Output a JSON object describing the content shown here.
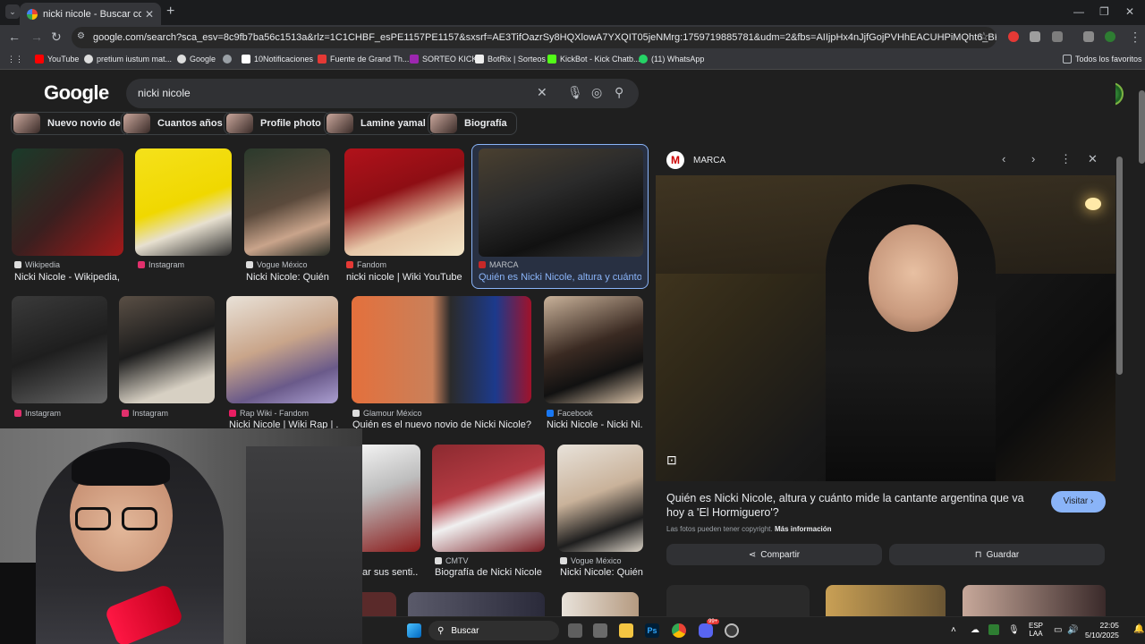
{
  "browser": {
    "tab_title": "nicki nicole - Buscar con Google",
    "url": "google.com/search?sca_esv=8c9fb7ba56c1513a&rlz=1C1CHBF_esPE1157PE1157&sxsrf=AE3TifOazrSy8HQXlowA7YXQIT05jeNMrg:1759719885781&udm=2&fbs=AIIjpHx4nJjfGojPVHhEACUHPiMQht6_BFq6vBIoFFRK7qchKHDX9TtpZ992ky...",
    "bookmarks": [
      "YouTube",
      "pretium iustum mat...",
      "Google",
      "",
      "10Notificaciones",
      "Fuente de Grand Th...",
      "SORTEO KICK",
      "BotRix | Sorteos",
      "KickBot - Kick Chatb...",
      "(11) WhatsApp"
    ],
    "all_bookmarks": "Todos los favoritos"
  },
  "google": {
    "logo": "Google",
    "query": "nicki nicole",
    "chips": [
      "Nuevo novio de",
      "Cuantos años",
      "Profile photo",
      "Lamine yamal",
      "Biografía"
    ]
  },
  "results": {
    "row1": [
      {
        "source": "Wikipedia",
        "title": "Nicki Nicole - Wikipedia, l..."
      },
      {
        "source": "Instagram",
        "title": ""
      },
      {
        "source": "Vogue México",
        "title": "Nicki Nicole: Quién ..."
      },
      {
        "source": "Fandom",
        "title": "nicki nicole | Wiki YouTube ..."
      },
      {
        "source": "MARCA",
        "title": "Quién es Nicki Nicole, altura y cuánto m..."
      }
    ],
    "row2": [
      {
        "source": "Instagram",
        "title": ""
      },
      {
        "source": "Instagram",
        "title": ""
      },
      {
        "source": "Rap Wiki - Fandom",
        "title": "Nicki Nicole | Wiki Rap | ..."
      },
      {
        "source": "Glamour México",
        "title": "Quién es el nuevo novio de Nicki Nicole? | ..."
      },
      {
        "source": "Facebook",
        "title": "Nicki Nicole - Nicki Ni..."
      }
    ],
    "row3": [
      {
        "source": "",
        "title": "ar sus senti..."
      },
      {
        "source": "CMTV",
        "title": "Biografía de Nicki Nicole"
      },
      {
        "source": "Vogue México",
        "title": "Nicki Nicole: Quién..."
      }
    ]
  },
  "panel": {
    "source": "MARCA",
    "logo_letter": "M",
    "title": "Quién es Nicki Nicole, altura y cuánto mide la cantante argentina que va hoy a 'El Hormiguero'?",
    "copyright": "Las fotos pueden tener copyright.",
    "more_info": "Más información",
    "visit": "Visitar",
    "share": "Compartir",
    "save": "Guardar"
  },
  "taskbar": {
    "search": "Buscar",
    "lang": "ESP",
    "lang_sub": "LAA",
    "time": "22:05",
    "date": "5/10/2025",
    "discord_badge": "99+"
  }
}
